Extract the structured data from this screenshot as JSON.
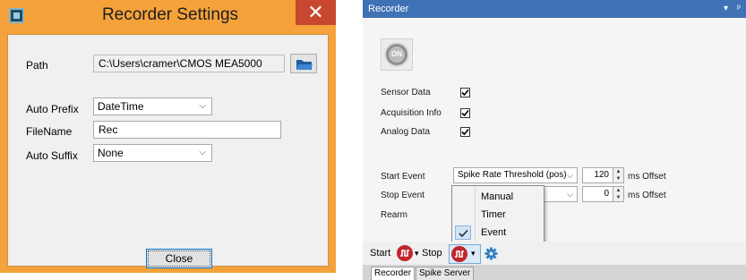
{
  "settings_dialog": {
    "title": "Recorder Settings",
    "close_glyph": "✕",
    "path_label": "Path",
    "path_value": "C:\\Users\\cramer\\CMOS MEA5000",
    "auto_prefix_label": "Auto Prefix",
    "auto_prefix_value": "DateTime",
    "filename_label": "FileName",
    "filename_value": "Rec",
    "auto_suffix_label": "Auto Suffix",
    "auto_suffix_value": "None",
    "close_button": "Close",
    "colors": {
      "frame": "#f5a23b",
      "close": "#c7472f"
    }
  },
  "recorder_panel": {
    "title": "Recorder",
    "title_buttons": [
      "▾",
      "ᵖ"
    ],
    "on_button": "ON",
    "checks": [
      {
        "label": "Sensor Data",
        "checked": true
      },
      {
        "label": "Acquisition Info",
        "checked": true
      },
      {
        "label": "Analog Data",
        "checked": true
      }
    ],
    "start_event_label": "Start Event",
    "start_event_value": "Spike Rate Threshold (pos)",
    "start_offset": "120",
    "offset_unit": "ms Offset",
    "stop_event_label": "Stop Event",
    "stop_offset": "0",
    "rearm_label": "Rearm",
    "dropdown_options": [
      {
        "label": "Manual",
        "selected": false
      },
      {
        "label": "Timer",
        "selected": false
      },
      {
        "label": "Event",
        "selected": true
      }
    ],
    "toolbar": {
      "start_label": "Start",
      "stop_label": "Stop"
    },
    "tabs": [
      {
        "label": "Recorder",
        "active": true
      },
      {
        "label": "Spike Server",
        "active": false
      }
    ],
    "colors": {
      "titlebar": "#3f72b5",
      "record_icon": "#c0272d",
      "gear": "#2f7fc4"
    }
  }
}
